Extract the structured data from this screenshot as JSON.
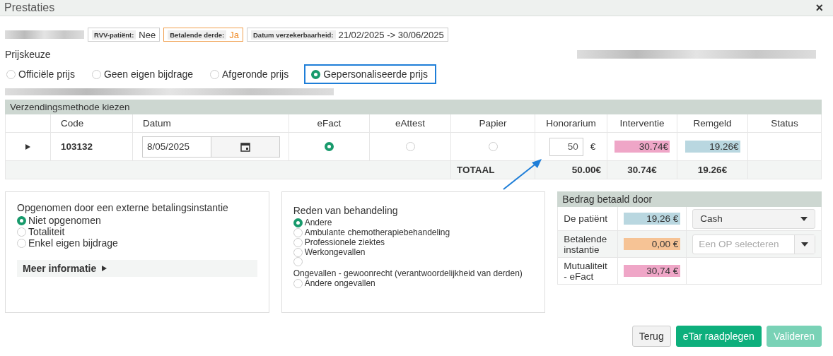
{
  "window": {
    "title": "Prestaties",
    "close": "×"
  },
  "info_tags": [
    {
      "label": "RVV-patiënt:",
      "value": "Nee",
      "highlight": false
    },
    {
      "label": "Betalende derde:",
      "value": "Ja",
      "highlight": true
    },
    {
      "label": "Datum verzekerbaarheid:",
      "value": "21/02/2025 -> 30/06/2025",
      "highlight": false
    }
  ],
  "price_choice": {
    "label": "Prijskeuze",
    "options": [
      {
        "label": "Officiële prijs",
        "selected": false
      },
      {
        "label": "Geen eigen bijdrage",
        "selected": false
      },
      {
        "label": "Afgeronde prijs",
        "selected": false
      },
      {
        "label": "Gepersonaliseerde prijs",
        "selected": true
      }
    ]
  },
  "table": {
    "section_title": "Verzendingsmethode kiezen",
    "columns": [
      "Code",
      "Datum",
      "eFact",
      "eAttest",
      "Papier",
      "Honorarium",
      "Interventie",
      "Remgeld",
      "Status"
    ],
    "rows": [
      {
        "code": "103132",
        "date": "8/05/2025",
        "methods": [
          {
            "selected": true
          },
          {
            "selected": false
          },
          {
            "selected": false
          }
        ],
        "honorarium": "50",
        "currency": "€",
        "interventie": "30.74€",
        "remgeld": "19.26€"
      }
    ],
    "totals": {
      "label": "TOTAAL",
      "honorarium": "50.00€",
      "interventie": "30.74€",
      "remgeld": "19.26€"
    }
  },
  "external_payer": {
    "title": "Opgenomen door een externe betalingsinstantie",
    "options": [
      {
        "label": "Niet opgenomen",
        "selected": true
      },
      {
        "label": "Totaliteit",
        "selected": false
      },
      {
        "label": "Enkel eigen bijdrage",
        "selected": false
      }
    ],
    "more_info": "Meer informatie"
  },
  "treatment_reason": {
    "title": "Reden van behandeling",
    "options": [
      {
        "label": "Andere",
        "selected": true
      },
      {
        "label": "Ambulante chemotherapiebehandeling",
        "selected": false
      },
      {
        "label": "Professionele ziektes",
        "selected": false
      },
      {
        "label": "Werkongevallen",
        "selected": false
      },
      {
        "label": "Ongevallen - gewoonrecht (verantwoordelijkheid van derden)",
        "selected": false
      },
      {
        "label": "Andere ongevallen",
        "selected": false
      }
    ]
  },
  "paid_by": {
    "title": "Bedrag betaald door",
    "rows": [
      {
        "label": "De patiënt",
        "amount": "19,26 €",
        "color": "#b9d7e0",
        "control": {
          "kind": "select",
          "value": "Cash"
        }
      },
      {
        "label": "Betalende instantie",
        "amount": "0,00 €",
        "color": "#f6c395",
        "control": {
          "kind": "combo",
          "placeholder": "Een OP selecteren"
        }
      },
      {
        "label": "Mutualiteit - eFact",
        "amount": "30,74 €",
        "color": "#efa6c7",
        "control": {
          "kind": "none"
        }
      }
    ]
  },
  "buttons": [
    {
      "label": "Terug",
      "kind": "default",
      "disabled": false
    },
    {
      "label": "eTar raadplegen",
      "kind": "primary",
      "disabled": false
    },
    {
      "label": "Valideren",
      "kind": "primary",
      "disabled": true
    }
  ]
}
